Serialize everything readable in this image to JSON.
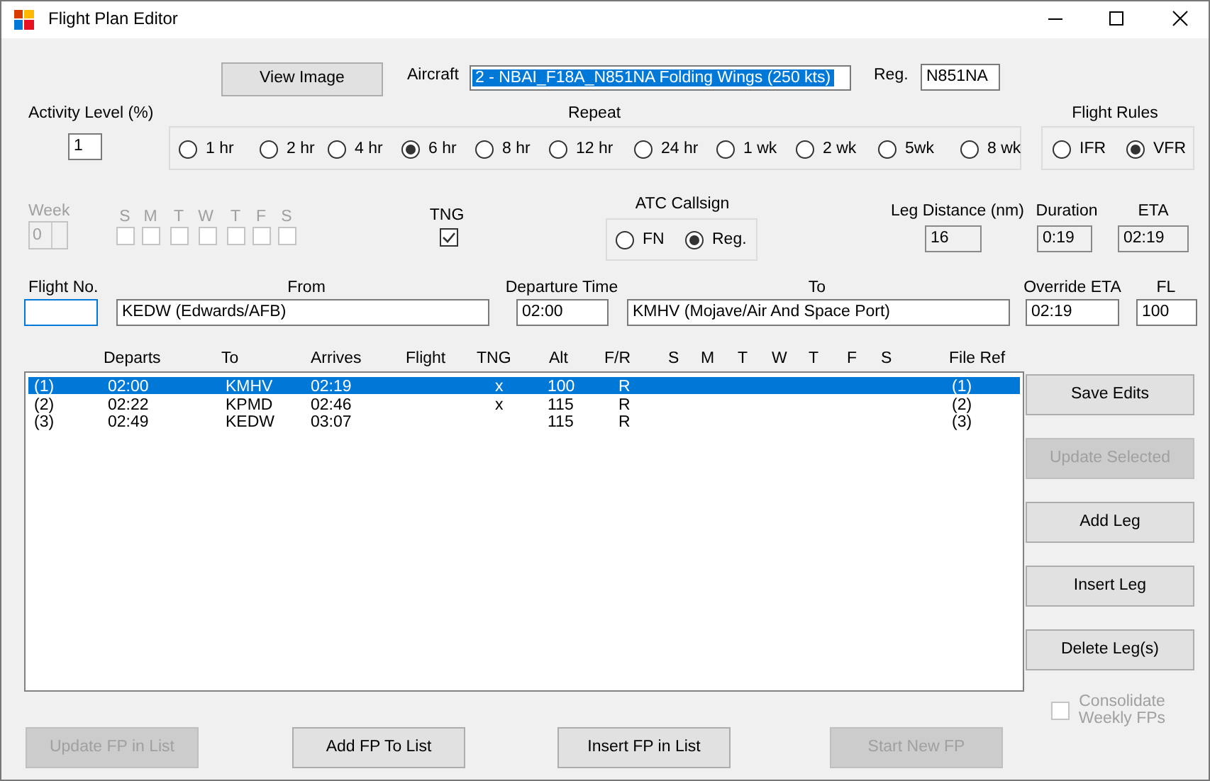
{
  "window": {
    "title": "Flight Plan Editor"
  },
  "view_image_button": {
    "label": "View Image"
  },
  "aircraft": {
    "label": "Aircraft",
    "value": "2 - NBAI_F18A_N851NA Folding Wings (250 kts)",
    "highlighted": true
  },
  "reg": {
    "label": "Reg.",
    "value": "N851NA"
  },
  "activity_level": {
    "label": "Activity Level (%)",
    "value": "1"
  },
  "repeat": {
    "label": "Repeat",
    "options": [
      {
        "label": "1 hr",
        "selected": false
      },
      {
        "label": "2 hr",
        "selected": false
      },
      {
        "label": "4 hr",
        "selected": false
      },
      {
        "label": "6 hr",
        "selected": true
      },
      {
        "label": "8 hr",
        "selected": false
      },
      {
        "label": "12 hr",
        "selected": false
      },
      {
        "label": "24 hr",
        "selected": false
      },
      {
        "label": "1 wk",
        "selected": false
      },
      {
        "label": "2 wk",
        "selected": false
      },
      {
        "label": "5wk",
        "selected": false
      },
      {
        "label": "8 wk",
        "selected": false
      }
    ]
  },
  "flight_rules": {
    "label": "Flight Rules",
    "options": [
      {
        "label": "IFR",
        "selected": false
      },
      {
        "label": "VFR",
        "selected": true
      }
    ]
  },
  "week": {
    "label": "Week",
    "value": "0",
    "disabled": true
  },
  "days": {
    "disabled": true,
    "items": [
      {
        "label": "S",
        "checked": false
      },
      {
        "label": "M",
        "checked": false
      },
      {
        "label": "T",
        "checked": false
      },
      {
        "label": "W",
        "checked": false
      },
      {
        "label": "T",
        "checked": false
      },
      {
        "label": "F",
        "checked": false
      },
      {
        "label": "S",
        "checked": false
      }
    ]
  },
  "tng": {
    "label": "TNG",
    "checked": true
  },
  "atc_callsign": {
    "label": "ATC Callsign",
    "options": [
      {
        "label": "FN",
        "selected": false
      },
      {
        "label": "Reg.",
        "selected": true
      }
    ]
  },
  "leg_distance": {
    "label": "Leg Distance (nm)",
    "value": "16",
    "readonly": true
  },
  "duration": {
    "label": "Duration",
    "value": "0:19",
    "readonly": true
  },
  "eta": {
    "label": "ETA",
    "value": "02:19",
    "readonly": true
  },
  "flight_no": {
    "label": "Flight No.",
    "focused": true
  },
  "from": {
    "label": "From",
    "value": "KEDW (Edwards/AFB)"
  },
  "departure_time": {
    "label": "Departure Time",
    "value": "02:00"
  },
  "to": {
    "label": "To",
    "value": "KMHV (Mojave/Air And Space Port)"
  },
  "override_eta": {
    "label": "Override ETA",
    "value": "02:19"
  },
  "fl": {
    "label": "FL",
    "value": "100"
  },
  "legs": {
    "columns": [
      "Departs",
      "To",
      "Arrives",
      "Flight",
      "TNG",
      "Alt",
      "F/R",
      "S",
      "M",
      "T",
      "W",
      "T",
      "F",
      "S",
      "File Ref"
    ],
    "rows": [
      {
        "number": "(1)",
        "cells": [
          "02:00",
          "KMHV",
          "02:19",
          null,
          "x",
          "100",
          "R",
          null,
          null,
          null,
          null,
          null,
          null,
          null,
          "(1)"
        ],
        "selected": true
      },
      {
        "number": "(2)",
        "cells": [
          "02:22",
          "KPMD",
          "02:46",
          null,
          "x",
          "115",
          "R",
          null,
          null,
          null,
          null,
          null,
          null,
          null,
          "(2)"
        ],
        "selected": false
      },
      {
        "number": "(3)",
        "cells": [
          "02:49",
          "KEDW",
          "03:07",
          null,
          null,
          "115",
          "R",
          null,
          null,
          null,
          null,
          null,
          null,
          null,
          "(3)"
        ],
        "selected": false
      }
    ]
  },
  "side_buttons": [
    {
      "label": "Save Edits",
      "disabled": false
    },
    {
      "label": "Update Selected",
      "disabled": true
    },
    {
      "label": "Add Leg",
      "disabled": false
    },
    {
      "label": "Insert Leg",
      "disabled": false
    },
    {
      "label": "Delete Leg(s)",
      "disabled": false
    }
  ],
  "consolidate": {
    "label": "Consolidate Weekly FPs",
    "checked": false,
    "disabled": true
  },
  "bottom_buttons": [
    {
      "label": "Update FP in List",
      "disabled": true
    },
    {
      "label": "Add FP To List",
      "disabled": false
    },
    {
      "label": "Insert FP in List",
      "disabled": false
    },
    {
      "label": "Start New FP",
      "disabled": true
    }
  ]
}
